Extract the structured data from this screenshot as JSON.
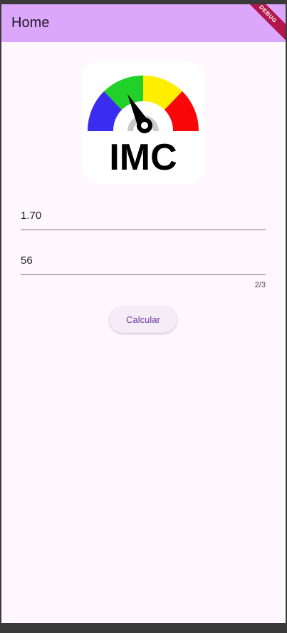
{
  "appbar": {
    "title": "Home",
    "debug_label": "DEBUG"
  },
  "logo": {
    "text": "IMC"
  },
  "form": {
    "height_value": "1.70",
    "weight_value": "56",
    "weight_counter": "2/3",
    "calculate_label": "Calcular"
  },
  "colors": {
    "appbar": "#dca6fc",
    "background": "#fff7fe",
    "button_text": "#6f3aa6",
    "gauge": [
      "#3a2cf0",
      "#22d02a",
      "#ffee00",
      "#f80808"
    ]
  }
}
